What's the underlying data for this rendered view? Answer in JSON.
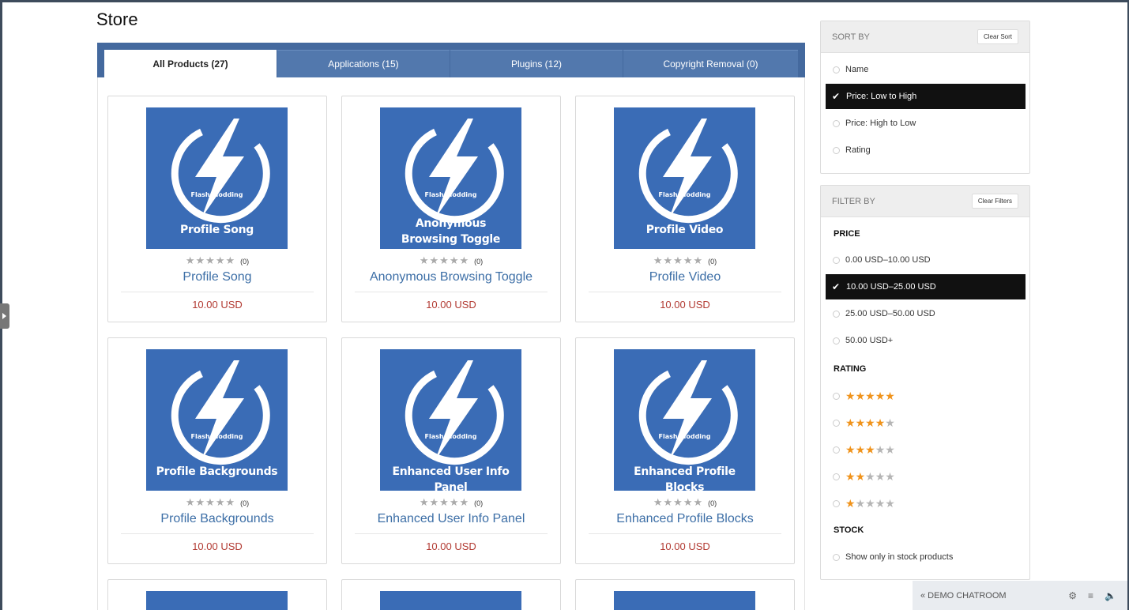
{
  "page": {
    "title": "Store"
  },
  "tabs": [
    {
      "label": "All Products (27)",
      "active": true
    },
    {
      "label": "Applications (15)",
      "active": false
    },
    {
      "label": "Plugins (12)",
      "active": false
    },
    {
      "label": "Copyright Removal (0)",
      "active": false
    }
  ],
  "brand_text": "Flash Modding",
  "products": [
    {
      "name": "Profile Song",
      "caption": [
        "Profile Song"
      ],
      "rating_count": "(0)",
      "price": "10.00 USD"
    },
    {
      "name": "Anonymous Browsing Toggle",
      "caption": [
        "Anonymous",
        "Browsing Toggle"
      ],
      "rating_count": "(0)",
      "price": "10.00 USD"
    },
    {
      "name": "Profile Video",
      "caption": [
        "Profile Video"
      ],
      "rating_count": "(0)",
      "price": "10.00 USD"
    },
    {
      "name": "Profile Backgrounds",
      "caption": [
        "Profile Backgrounds"
      ],
      "rating_count": "(0)",
      "price": "10.00 USD"
    },
    {
      "name": "Enhanced User Info Panel",
      "caption": [
        "Enhanced User Info Panel"
      ],
      "rating_count": "(0)",
      "price": "10.00 USD"
    },
    {
      "name": "Enhanced Profile Blocks",
      "caption": [
        "Enhanced Profile Blocks"
      ],
      "rating_count": "(0)",
      "price": "10.00 USD"
    }
  ],
  "sort": {
    "title": "SORT BY",
    "clear_label": "Clear Sort",
    "options": [
      {
        "label": "Name",
        "selected": false
      },
      {
        "label": "Price: Low to High",
        "selected": true
      },
      {
        "label": "Price: High to Low",
        "selected": false
      },
      {
        "label": "Rating",
        "selected": false
      }
    ]
  },
  "filter": {
    "title": "FILTER BY",
    "clear_label": "Clear Filters",
    "price_label": "PRICE",
    "price_options": [
      {
        "label": "0.00 USD–10.00 USD",
        "selected": false
      },
      {
        "label": "10.00 USD–25.00 USD",
        "selected": true
      },
      {
        "label": "25.00 USD–50.00 USD",
        "selected": false
      },
      {
        "label": "50.00 USD+",
        "selected": false
      }
    ],
    "rating_label": "RATING",
    "rating_options": [
      5,
      4,
      3,
      2,
      1
    ],
    "stock_label": "STOCK",
    "stock_option": "Show only in stock products"
  },
  "chat": {
    "label": "« DEMO CHATROOM",
    "icons": [
      "gears-icon",
      "menu-icon",
      "volume-icon"
    ]
  },
  "colors": {
    "tab_bar": "#44699e",
    "product_tile": "#3a6cb6",
    "price": "#b23a32",
    "link": "#3c6ea6",
    "star": "#f0931b"
  }
}
